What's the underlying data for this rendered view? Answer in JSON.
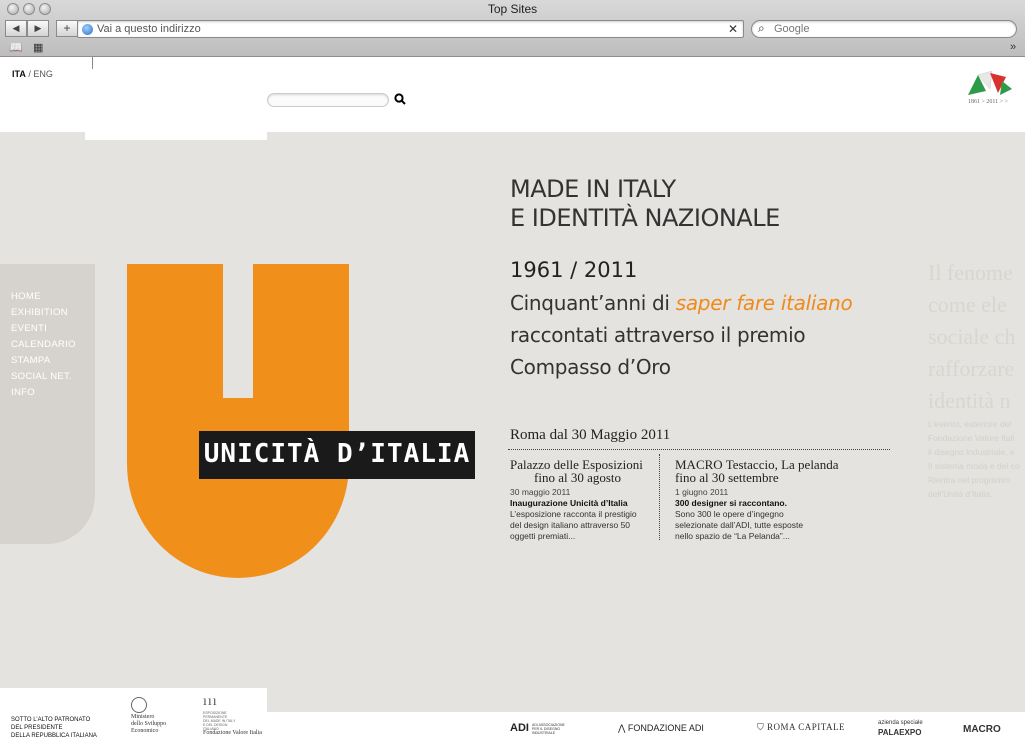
{
  "browser": {
    "window_title": "Top Sites",
    "url_placeholder": "Vai a questo indirizzo",
    "search_placeholder": "Google"
  },
  "header": {
    "lang_active": "ITA",
    "lang_sep": " / ",
    "lang_other": "ENG",
    "logo_caption": "1861 > 2011 > >"
  },
  "menu": [
    "HOME",
    "EXHIBITION",
    "EVENTI",
    "CALENDARIO",
    "STAMPA",
    "SOCIAL NET.",
    "INFO"
  ],
  "brand": {
    "name": "UNICITÀ D’ITALIA",
    "accent": "#f0901a"
  },
  "hero": {
    "headline_line1": "MADE IN ITALY",
    "headline_line2": "E IDENTITÀ NAZIONALE",
    "years": "1961 / 2011",
    "lead1_prefix": "Cinquant’anni di ",
    "lead1_highlight": "saper fare italiano",
    "lead2": "raccontati attraverso il premio",
    "lead3": "Compasso d’Oro"
  },
  "events": {
    "location_line": "Roma dal 30 Maggio 2011",
    "left": {
      "venue": "Palazzo delle Esposizioni",
      "until": "fino al 30 agosto",
      "date": "30 maggio 2011",
      "title": "Inaugurazione Unicità d’Italia",
      "text_lines": [
        "L’esposizione racconta il prestigio",
        "del design italiano attraverso 50",
        "oggetti premiati..."
      ]
    },
    "right": {
      "venue": "MACRO Testaccio, La pelanda",
      "until": "fino al 30 settembre",
      "date": "1 giugno 2011",
      "title": "300 designer si raccontano.",
      "text_lines": [
        "Sono 300 le opere d’ingegno",
        "selezionate dall’ADI, tutte esposte",
        "nello spazio de “La Pelanda”..."
      ]
    }
  },
  "faded": {
    "big_lines": [
      "Il fenome",
      "come ele",
      "sociale ch",
      "rafforzare",
      "identità n"
    ],
    "small_lines": [
      "L’evento, esteriore del",
      "Fondazione Valore Itali",
      "il disegno industriale, e",
      "Il sistema moda e dei co",
      "Rientra nel programm",
      "dell’Unità d’Italia."
    ]
  },
  "footer": {
    "patronage": [
      "SOTTO L’ALTO PATRONATO",
      "DEL PRESIDENTE",
      "DELLA REPUBBLICA ITALIANA"
    ],
    "mise": [
      "Ministero",
      "dello Sviluppo",
      "Economico"
    ],
    "fvi_mark": "ııı",
    "fvi_small": [
      "ESPOSIZIONE",
      "PERMANENTE",
      "DEL MADE IN ITALY",
      "E DEL DESIGN",
      "ITALIANO"
    ],
    "fvi_name": "Fondazione Valore Italia",
    "adi": "ADI",
    "adi_small": [
      "ADI ASSOCIAZIONE",
      "PER IL DISEGNO",
      "INDUSTRIALE"
    ],
    "fondazione_adi": "FONDAZIONE ADI",
    "roma": "ROMA CAPITALE",
    "pala_top": "azienda speciale",
    "pala": "PALAEXPO",
    "macro": "MACRO"
  }
}
